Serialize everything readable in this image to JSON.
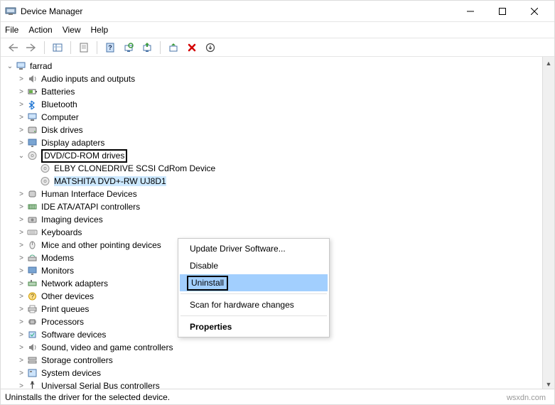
{
  "window": {
    "title": "Device Manager"
  },
  "menu": {
    "file": "File",
    "action": "Action",
    "view": "View",
    "help": "Help"
  },
  "tree": {
    "root": "farrad",
    "items": [
      "Audio inputs and outputs",
      "Batteries",
      "Bluetooth",
      "Computer",
      "Disk drives",
      "Display adapters"
    ],
    "dvd": {
      "label": "DVD/CD-ROM drives",
      "children": [
        "ELBY CLONEDRIVE SCSI CdRom Device",
        "MATSHITA DVD+-RW UJ8D1"
      ]
    },
    "rest": [
      "Human Interface Devices",
      "IDE ATA/ATAPI controllers",
      "Imaging devices",
      "Keyboards",
      "Mice and other pointing devices",
      "Modems",
      "Monitors",
      "Network adapters",
      "Other devices",
      "Print queues",
      "Processors",
      "Software devices",
      "Sound, video and game controllers",
      "Storage controllers",
      "System devices",
      "Universal Serial Bus controllers"
    ]
  },
  "contextMenu": {
    "update": "Update Driver Software...",
    "disable": "Disable",
    "uninstall": "Uninstall",
    "scan": "Scan for hardware changes",
    "properties": "Properties"
  },
  "status": "Uninstalls the driver for the selected device.",
  "watermark": "wsxdn.com"
}
